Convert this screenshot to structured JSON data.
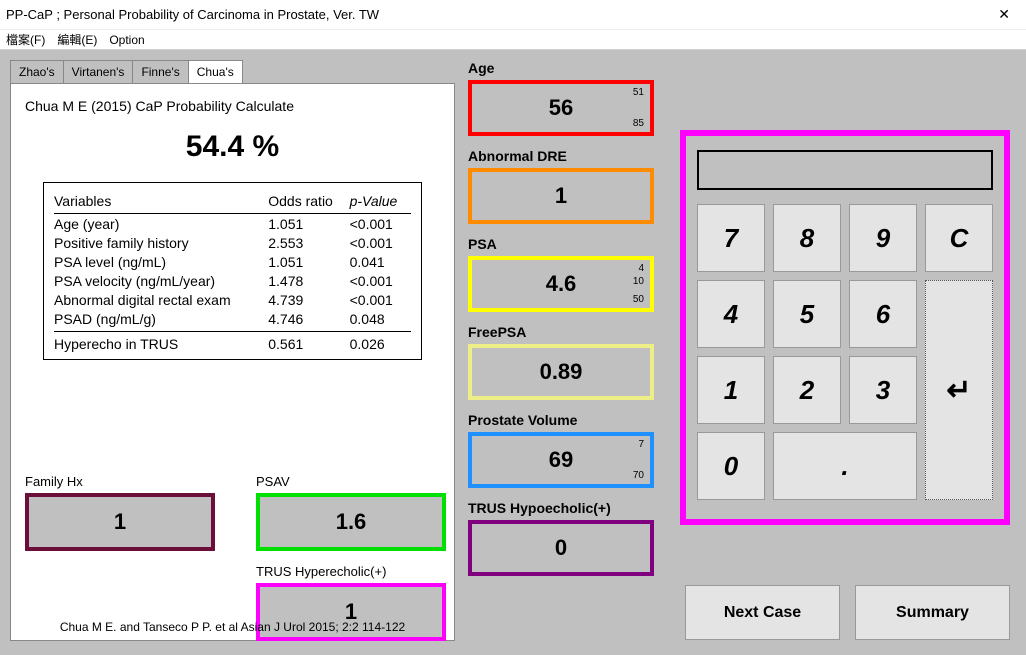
{
  "window": {
    "title": "PP-CaP ; Personal Probability of Carcinoma in Prostate, Ver. TW"
  },
  "menu": {
    "file": "檔案(F)",
    "edit": "編輯(E)",
    "option": "Option"
  },
  "tabs": [
    "Zhao's",
    "Virtanen's",
    "Finne's",
    "Chua's"
  ],
  "active_tab": 3,
  "panel": {
    "heading": "Chua M E (2015) CaP Probability Calculate",
    "percent": "54.4 %",
    "table": {
      "headers": [
        "Variables",
        "Odds ratio",
        "p-Value"
      ],
      "rows": [
        [
          "Age (year)",
          "1.051",
          "<0.001"
        ],
        [
          "Positive family history",
          "2.553",
          "<0.001"
        ],
        [
          "PSA level (ng/mL)",
          "1.051",
          "0.041"
        ],
        [
          "PSA velocity (ng/mL/year)",
          "1.478",
          "<0.001"
        ],
        [
          "Abnormal digital rectal exam",
          "4.739",
          "<0.001"
        ],
        [
          "PSAD (ng/mL/g)",
          "4.746",
          "0.048"
        ],
        [
          "Hyperecho in TRUS",
          "0.561",
          "0.026"
        ]
      ]
    },
    "family_hx": {
      "label": "Family Hx",
      "value": "1"
    },
    "psav": {
      "label": "PSAV",
      "value": "1.6"
    },
    "trus_hyper": {
      "label": "TRUS Hyperecholic(+)",
      "value": "1"
    },
    "citation": "Chua M E. and Tanseco P P. et al   Asian J Urol  2015; 2:2 114-122"
  },
  "inputs": {
    "age": {
      "label": "Age",
      "value": "56",
      "hint_top": "51",
      "hint_bot": "85"
    },
    "dre": {
      "label": "Abnormal DRE",
      "value": "1"
    },
    "psa": {
      "label": "PSA",
      "value": "4.6",
      "hint_top": "4",
      "hint_mid": "10",
      "hint_bot": "50"
    },
    "freepsa": {
      "label": "FreePSA",
      "value": "0.89"
    },
    "pv": {
      "label": "Prostate Volume",
      "value": "69",
      "hint_top": "7",
      "hint_bot": "70"
    },
    "trus_hypo": {
      "label": "TRUS Hypoecholic(+)",
      "value": "0"
    }
  },
  "keypad": {
    "display": "",
    "keys": {
      "k7": "7",
      "k8": "8",
      "k9": "9",
      "kc": "C",
      "k4": "4",
      "k5": "5",
      "k6": "6",
      "k1": "1",
      "k2": "2",
      "k3": "3",
      "k0": "0",
      "kdot": ".",
      "enter": "↵"
    }
  },
  "buttons": {
    "next": "Next Case",
    "summary": "Summary"
  },
  "colors": {
    "age": "#ff0000",
    "dre": "#ff8c00",
    "psa": "#ffff00",
    "freepsa": "#eeee88",
    "pv": "#1e90ff",
    "hypo": "#800080",
    "familyhx": "#6b0f3a",
    "psav": "#00e000",
    "hyper": "#ff00ff",
    "keypad": "#ff00ff"
  }
}
